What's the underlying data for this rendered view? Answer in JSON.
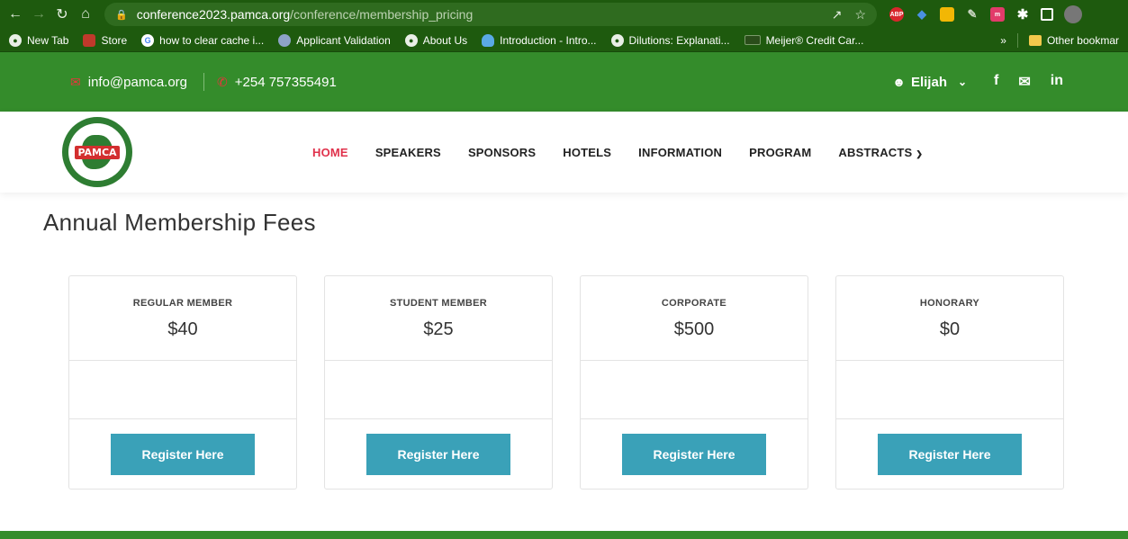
{
  "browser": {
    "url_host": "conference2023.pamca.org",
    "url_path": "/conference/membership_pricing",
    "bookmarks": [
      {
        "label": "New Tab",
        "icon": "globe-icon"
      },
      {
        "label": "Store",
        "icon": "store-icon"
      },
      {
        "label": "how to clear cache i...",
        "icon": "google-icon"
      },
      {
        "label": "Applicant Validation",
        "icon": "validation-icon"
      },
      {
        "label": "About Us",
        "icon": "globe-icon"
      },
      {
        "label": "Introduction - Intro...",
        "icon": "cloud-icon"
      },
      {
        "label": "Dilutions: Explanati...",
        "icon": "globe-icon"
      },
      {
        "label": "Meijer® Credit Car...",
        "icon": "card-icon"
      }
    ],
    "bookmarks_overflow": "»",
    "other_bookmarks": "Other bookmar",
    "extensions": {
      "abp": "ABP"
    }
  },
  "topbar": {
    "email": "info@pamca.org",
    "phone": "+254 757355491",
    "user_name": "Elijah",
    "social": {
      "facebook": "f",
      "twitter": "🐦",
      "linkedin": "in"
    }
  },
  "header": {
    "logo_text": "PAMCA",
    "nav": [
      {
        "label": "HOME",
        "active": true
      },
      {
        "label": "SPEAKERS"
      },
      {
        "label": "SPONSORS"
      },
      {
        "label": "HOTELS"
      },
      {
        "label": "INFORMATION"
      },
      {
        "label": "PROGRAM"
      },
      {
        "label": "ABSTRACTS",
        "dropdown": true
      }
    ]
  },
  "main": {
    "title": "Annual Membership Fees",
    "plans": [
      {
        "name": "REGULAR MEMBER",
        "price": "$40",
        "button": "Register Here"
      },
      {
        "name": "STUDENT MEMBER",
        "price": "$25",
        "button": "Register Here"
      },
      {
        "name": "CORPORATE",
        "price": "$500",
        "button": "Register Here"
      },
      {
        "name": "HONORARY",
        "price": "$0",
        "button": "Register Here"
      }
    ]
  },
  "colors": {
    "browser_green": "#1e5a0e",
    "site_green": "#348c2b",
    "active_nav": "#e0314b",
    "button": "#3aa1b8"
  }
}
